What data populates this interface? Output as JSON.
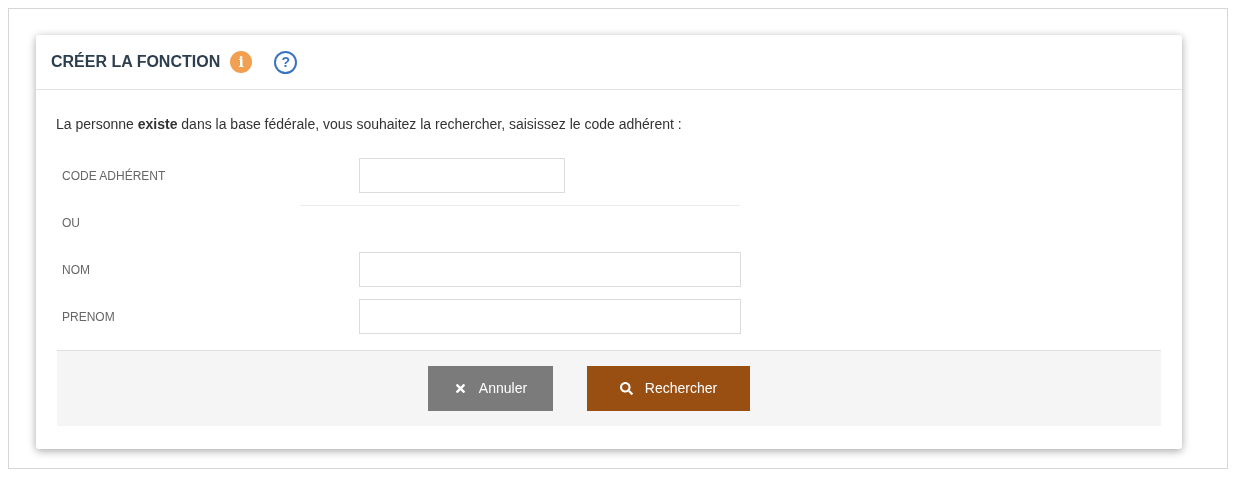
{
  "panel": {
    "title": "CRÉER LA FONCTION",
    "info_icon": "i",
    "help_icon": "?"
  },
  "intro": "La personne **existe** dans la base fédérale, vous souhaitez la rechercher, saisissez le code adhérent :",
  "rows": [
    {
      "kind": "code",
      "label": "CODE ADHÉRENT"
    },
    {
      "kind": "separator",
      "label": "OU"
    },
    {
      "kind": "input",
      "label": "NOM"
    },
    {
      "kind": "input",
      "label": "PRENOM"
    }
  ],
  "buttons": [
    {
      "kind": "cancel",
      "label": "Annuler"
    },
    {
      "kind": "search",
      "label": "Rechercher"
    }
  ]
}
